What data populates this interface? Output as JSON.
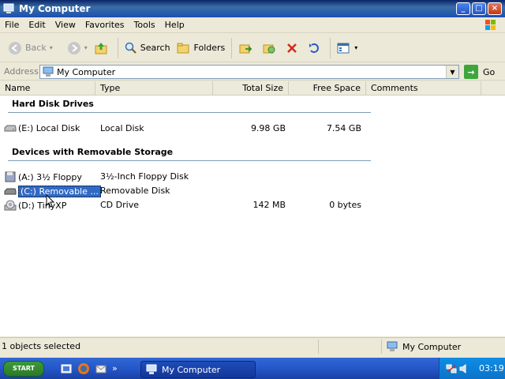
{
  "window": {
    "title": "My Computer"
  },
  "menu": {
    "items": [
      {
        "label": "File"
      },
      {
        "label": "Edit"
      },
      {
        "label": "View"
      },
      {
        "label": "Favorites"
      },
      {
        "label": "Tools"
      },
      {
        "label": "Help"
      }
    ]
  },
  "toolbar": {
    "back": "Back",
    "search": "Search",
    "folders": "Folders"
  },
  "address": {
    "label": "Address",
    "value": "My Computer",
    "go": "Go"
  },
  "columns": [
    "Name",
    "Type",
    "Total Size",
    "Free Space",
    "Comments"
  ],
  "groups": [
    {
      "title": "Hard Disk Drives",
      "items": [
        {
          "name": "(E:) Local Disk",
          "type": "Local Disk",
          "total": "9.98 GB",
          "free": "7.54 GB"
        }
      ]
    },
    {
      "title": "Devices with Removable Storage",
      "items": [
        {
          "name": "(A:) 3½ Floppy",
          "type": "3½-Inch Floppy Disk",
          "total": "",
          "free": ""
        },
        {
          "name": "(C:) Removable ...",
          "type": "Removable Disk",
          "total": "",
          "free": ""
        },
        {
          "name": "(D:) TinyXP",
          "type": "CD Drive",
          "total": "142 MB",
          "free": "0 bytes"
        }
      ]
    }
  ],
  "status": {
    "selected": "1 objects selected",
    "location": "My Computer"
  },
  "taskbar": {
    "start": "START",
    "task": "My Computer",
    "time": "03:19"
  },
  "colors": {
    "titlebar": "#0a246a",
    "selection": "#316ac5",
    "taskbar": "#2457c9",
    "tray": "#0f8ee6"
  }
}
